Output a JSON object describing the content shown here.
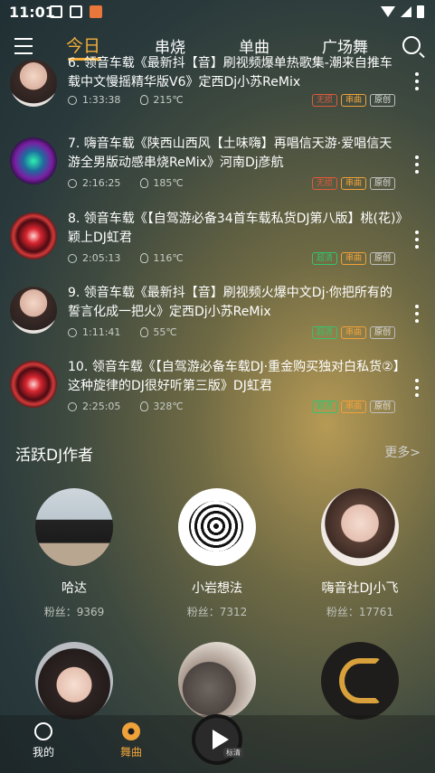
{
  "status_bar": {
    "time": "11:01"
  },
  "tabs": [
    "今日",
    "串烧",
    "单曲",
    "广场舞"
  ],
  "list": [
    {
      "title": "6. 领音车载《最新抖【音】刷视频爆单热歌集-潮来自推车载中文慢摇精华版V6》定西Dj小苏ReMix",
      "duration": "1:33:38",
      "heat": "215℃",
      "badges": [
        "无损",
        "串曲",
        "原创"
      ]
    },
    {
      "title": "7. 嗨音车载《陕西山西风【土味嗨】再唱信天游·爱唱信天游全男版动感串烧ReMix》河南Dj彦航",
      "duration": "2:16:25",
      "heat": "185℃",
      "badges": [
        "无损",
        "串曲",
        "原创"
      ]
    },
    {
      "title": "8. 领音车载《【自驾游必备34首车载私货DJ第八版】桃(花)》颖上DJ虹君",
      "duration": "2:05:13",
      "heat": "116℃",
      "badges": [
        "超清",
        "串曲",
        "原创"
      ]
    },
    {
      "title": "9. 领音车载《最新抖【音】刷视频火爆中文Dj·你把所有的誓言化成一把火》定西Dj小苏ReMix",
      "duration": "1:11:41",
      "heat": "55℃",
      "badges": [
        "超清",
        "串曲",
        "原创"
      ]
    },
    {
      "title": "10. 领音车载《【自驾游必备车载DJ·重金购买独对白私货②】这种旋律的DJ很好听第三版》DJ虹君",
      "duration": "2:25:05",
      "heat": "328℃",
      "badges": [
        "超清",
        "串曲",
        "原创"
      ]
    }
  ],
  "section": {
    "title": "活跃DJ作者",
    "more": "更多>"
  },
  "djs": [
    {
      "name": "哈达",
      "fans": "粉丝：9369"
    },
    {
      "name": "小岩想法",
      "fans": "粉丝：7312"
    },
    {
      "name": "嗨音社DJ小飞",
      "fans": "粉丝：17761"
    }
  ],
  "bottom_nav": {
    "mine": "我的",
    "dance": "舞曲",
    "player_tag": "标清"
  },
  "colors": {
    "accent": "#f4b03a",
    "badge_red": "#e05a3c",
    "badge_orange": "#f0a23a",
    "badge_green": "#36c36e"
  }
}
